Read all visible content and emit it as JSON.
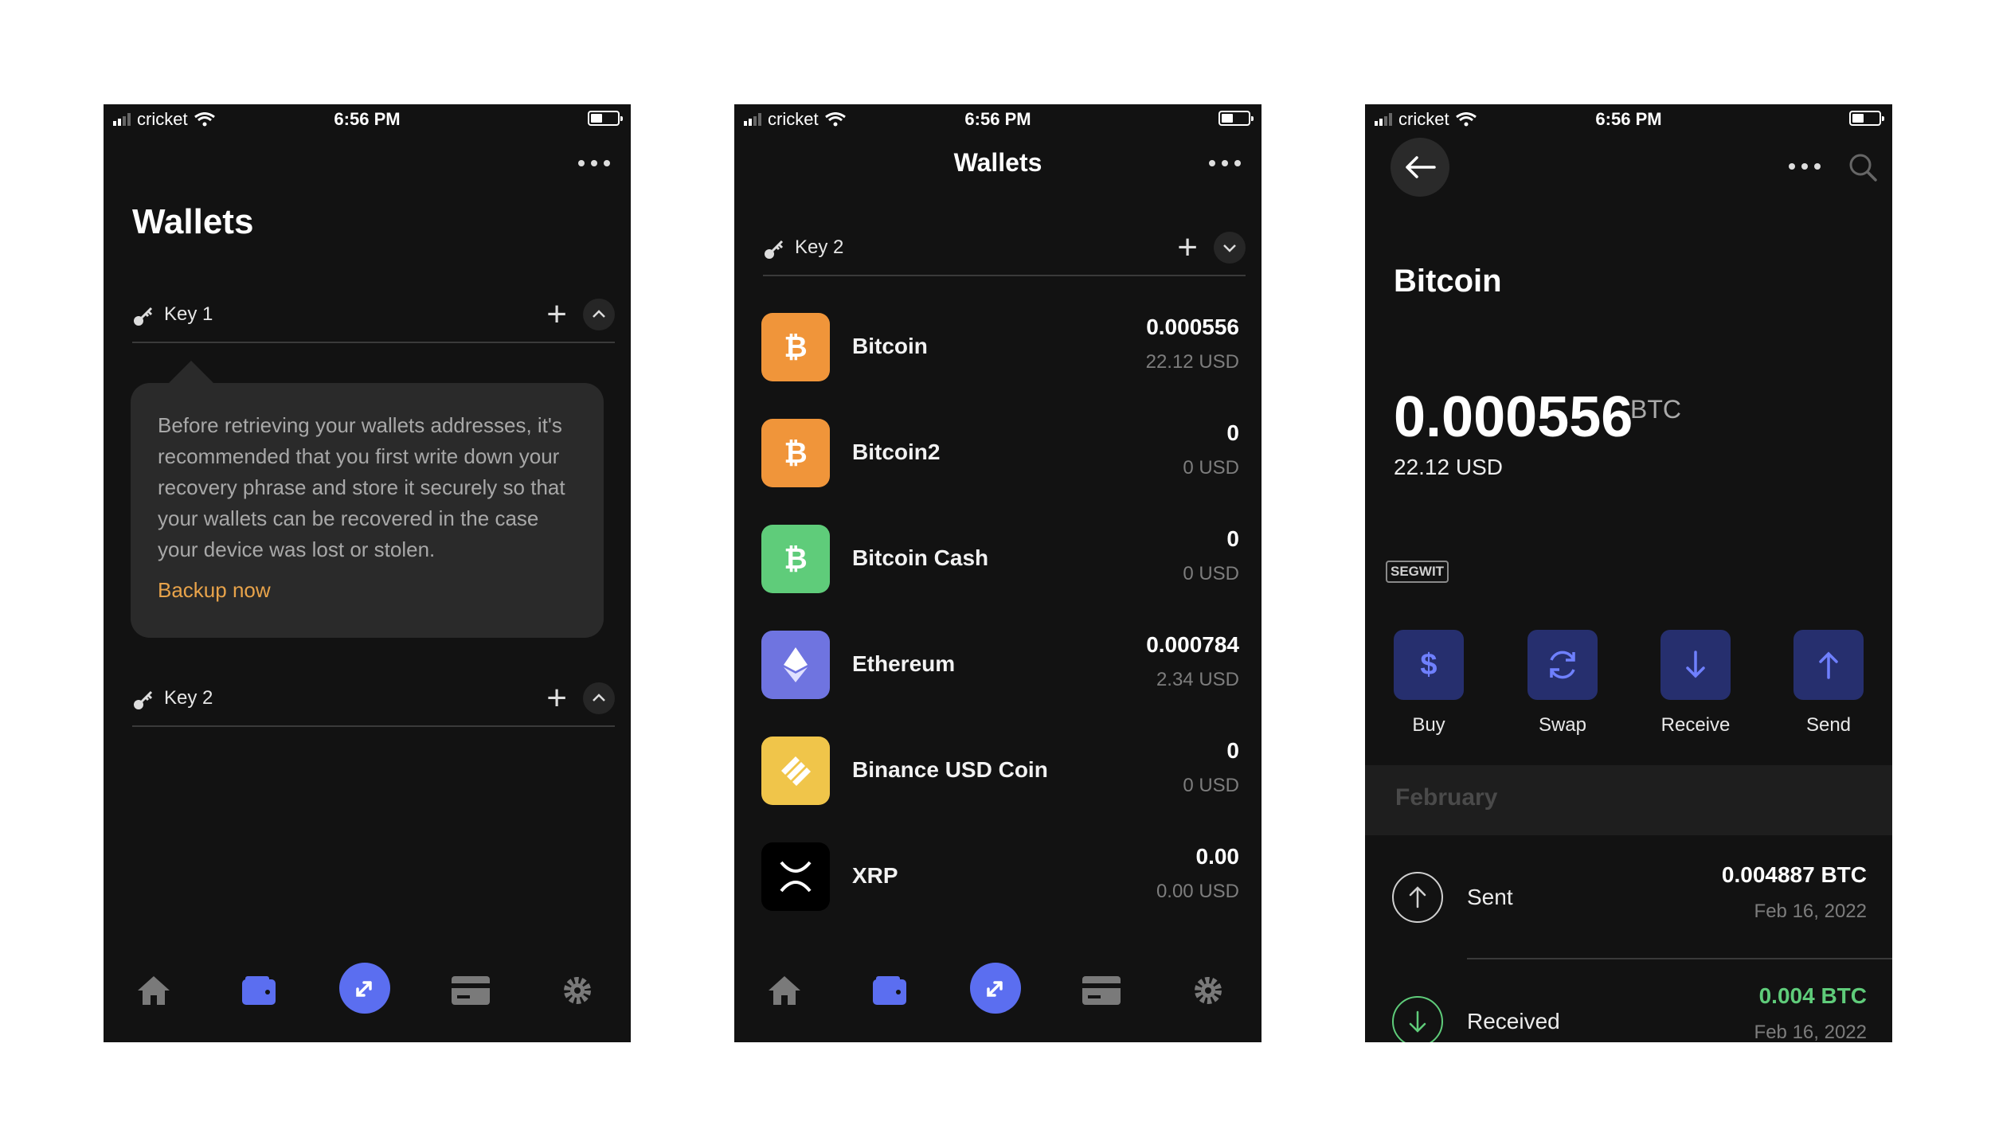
{
  "status": {
    "carrier": "cricket",
    "time": "6:56 PM"
  },
  "screen1": {
    "title": "Wallets",
    "key1_label": "Key 1",
    "key2_label": "Key 2",
    "tip_text": "Before retrieving your wallets addresses, it's recommended that you first write down your recovery phrase and store it securely so that your wallets can be recovered in the case your device was lost or stolen.",
    "backup_label": "Backup now"
  },
  "screen2": {
    "title": "Wallets",
    "key_label": "Key 2",
    "wallets": [
      {
        "name": "Bitcoin",
        "amount": "0.000556",
        "usd": "22.12 USD",
        "color": "#f0953a"
      },
      {
        "name": "Bitcoin2",
        "amount": "0",
        "usd": "0 USD",
        "color": "#f0953a"
      },
      {
        "name": "Bitcoin Cash",
        "amount": "0",
        "usd": "0 USD",
        "color": "#5fcc7a"
      },
      {
        "name": "Ethereum",
        "amount": "0.000784",
        "usd": "2.34 USD",
        "color": "#6f74e0"
      },
      {
        "name": "Binance USD Coin",
        "amount": "0",
        "usd": "0 USD",
        "color": "#f0c54a"
      },
      {
        "name": "XRP",
        "amount": "0.00",
        "usd": "0.00 USD",
        "color": "#000000"
      }
    ]
  },
  "screen3": {
    "coin_title": "Bitcoin",
    "balance": "0.000556",
    "balance_unit": "BTC",
    "balance_usd": "22.12 USD",
    "badge": "SEGWIT",
    "actions": [
      "Buy",
      "Swap",
      "Receive",
      "Send"
    ],
    "month": "February",
    "transactions": [
      {
        "label": "Sent",
        "amount": "0.004887 BTC",
        "date": "Feb 16, 2022",
        "color": "#ffffff"
      },
      {
        "label": "Received",
        "amount": "0.004 BTC",
        "date": "Feb 16, 2022",
        "color": "#5fcc7a"
      }
    ]
  },
  "colors": {
    "accent": "#5b6ef0",
    "backup": "#e8a34a",
    "action_bg": "#262f6e",
    "received": "#5fcc7a"
  }
}
